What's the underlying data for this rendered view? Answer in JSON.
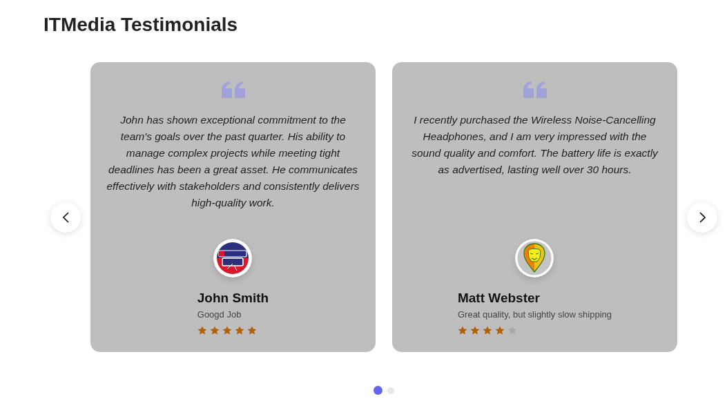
{
  "title": "ITMedia Testimonials",
  "carousel": {
    "testimonials": [
      {
        "kind": "badge",
        "quote": "John has shown exceptional commitment to the team's goals over the past quarter. His ability to manage complex projects while meeting tight deadlines has been a great asset. He communicates effectively with stakeholders and consistently delivers high-quality work.",
        "name": "John Smith",
        "headline": "Googd Job",
        "stars": 5
      },
      {
        "kind": "shield",
        "quote": "I recently purchased the Wireless Noise-Cancelling Headphones, and I am very impressed with the sound quality and comfort. The battery life is exactly as advertised, lasting well over 30 hours.",
        "name": "Matt Webster",
        "headline": "Great quality, but slightly slow shipping",
        "stars": 4
      }
    ],
    "pagination": [
      {
        "selected": true
      },
      {
        "selected": false
      }
    ]
  }
}
